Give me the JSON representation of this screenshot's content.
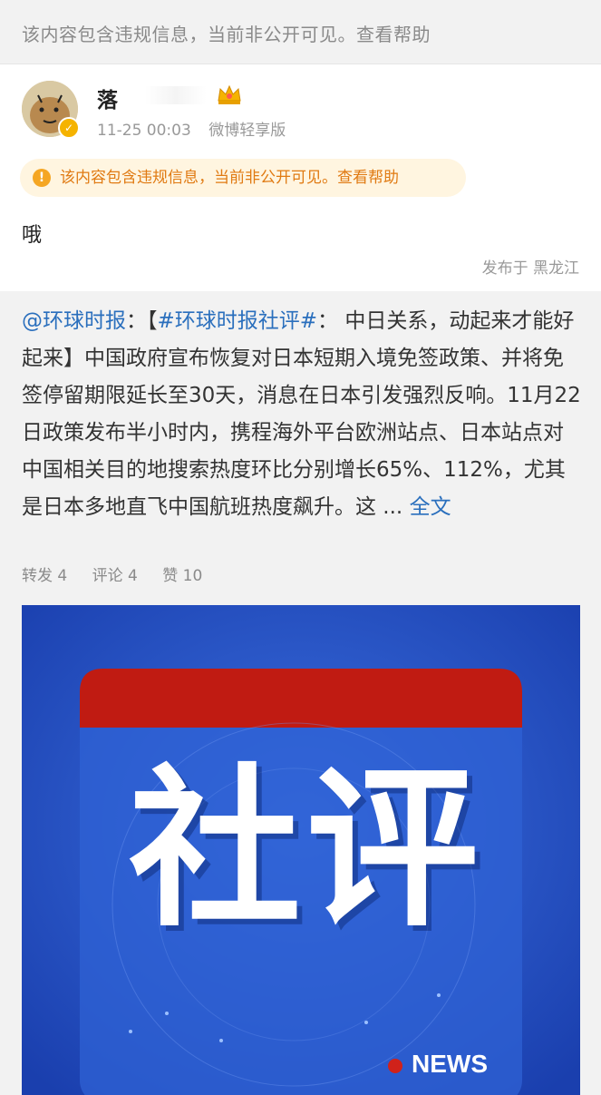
{
  "banner": {
    "text": "该内容包含违规信息，当前非公开可见。查看帮助"
  },
  "post": {
    "username": "落",
    "timestamp": "11-25 00:03",
    "source": "微博轻享版",
    "notice": "该内容包含违规信息，当前非公开可见。查看帮助",
    "text": "哦",
    "location": "发布于 黑龙江"
  },
  "repost": {
    "mention": "@环球时报",
    "colon": "：【",
    "hashtag": "#环球时报社评#",
    "body": "： 中日关系，动起来才能好起来】中国政府宣布恢复对日本短期入境免签政策、并将免签停留期限延长至30天，消息在日本引发强烈反响。11月22日政策发布半小时内，携程海外平台欧洲站点、日本站点对中国相关目的地搜索热度环比分别增长65%、112%，尤其是日本多地直飞中国航班热度飙升。这 ...",
    "more": "全文",
    "actions": {
      "repost": "转发 4",
      "comment": "评论 4",
      "like": "赞 10"
    },
    "image": {
      "headline": "社评",
      "label": "NEWS"
    }
  },
  "colors": {
    "link": "#2a6fbd",
    "notice": "#e07a12",
    "image_blue": "#1d47b8",
    "image_red": "#c01b12"
  }
}
